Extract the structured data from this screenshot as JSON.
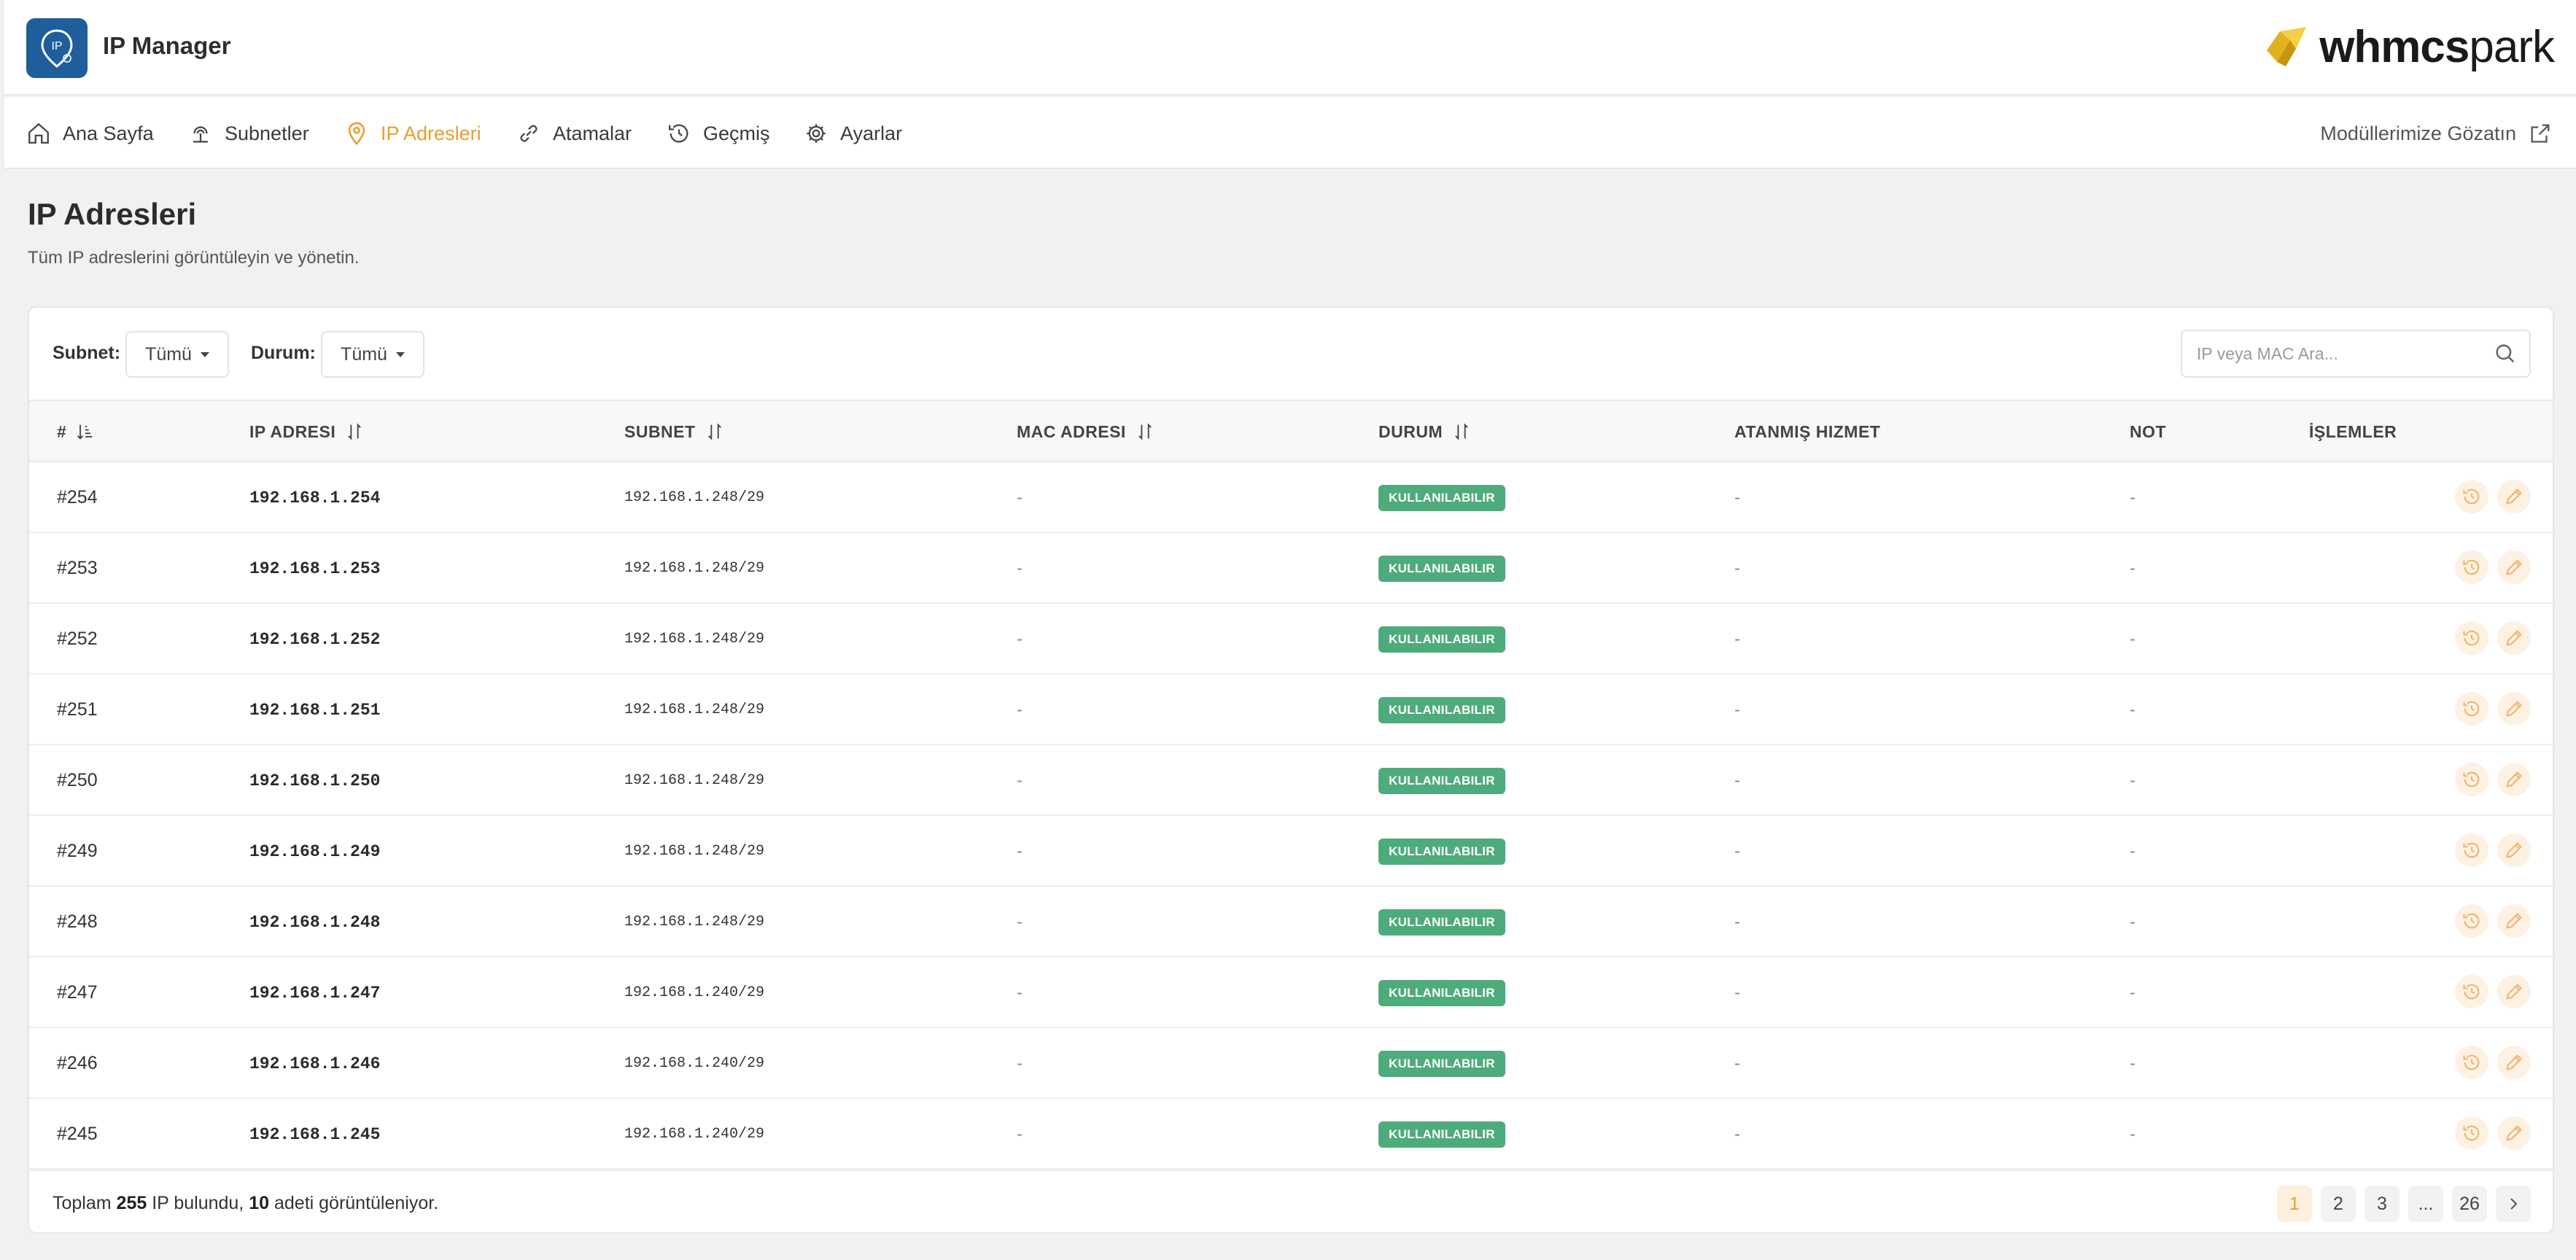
{
  "header": {
    "logo_text": "IP",
    "app_title": "IP Manager",
    "brand_bold": "whmcs",
    "brand_light": "park"
  },
  "nav": {
    "items": [
      {
        "label": "Ana Sayfa",
        "icon": "home-icon"
      },
      {
        "label": "Subnetler",
        "icon": "network-icon"
      },
      {
        "label": "IP Adresleri",
        "icon": "map-pin-icon",
        "active": true
      },
      {
        "label": "Atamalar",
        "icon": "link-icon"
      },
      {
        "label": "Geçmiş",
        "icon": "history-icon"
      },
      {
        "label": "Ayarlar",
        "icon": "gear-icon"
      }
    ],
    "external_link": "Modüllerimize Gözatın"
  },
  "page": {
    "title": "IP Adresleri",
    "subtitle": "Tüm IP adreslerini görüntüleyin ve yönetin."
  },
  "filters": {
    "subnet_label": "Subnet:",
    "subnet_value": "Tümü",
    "status_label": "Durum:",
    "status_value": "Tümü",
    "search_placeholder": "IP veya MAC Ara..."
  },
  "table": {
    "columns": [
      "#",
      "IP ADRESI",
      "SUBNET",
      "MAC ADRESI",
      "DURUM",
      "ATANMIŞ HIZMET",
      "NOT",
      "İŞLEMLER"
    ],
    "rows": [
      {
        "id": "#254",
        "ip": "192.168.1.254",
        "subnet": "192.168.1.248/29",
        "mac": "-",
        "status": "KULLANILABILIR",
        "service": "-",
        "note": "-"
      },
      {
        "id": "#253",
        "ip": "192.168.1.253",
        "subnet": "192.168.1.248/29",
        "mac": "-",
        "status": "KULLANILABILIR",
        "service": "-",
        "note": "-"
      },
      {
        "id": "#252",
        "ip": "192.168.1.252",
        "subnet": "192.168.1.248/29",
        "mac": "-",
        "status": "KULLANILABILIR",
        "service": "-",
        "note": "-"
      },
      {
        "id": "#251",
        "ip": "192.168.1.251",
        "subnet": "192.168.1.248/29",
        "mac": "-",
        "status": "KULLANILABILIR",
        "service": "-",
        "note": "-"
      },
      {
        "id": "#250",
        "ip": "192.168.1.250",
        "subnet": "192.168.1.248/29",
        "mac": "-",
        "status": "KULLANILABILIR",
        "service": "-",
        "note": "-"
      },
      {
        "id": "#249",
        "ip": "192.168.1.249",
        "subnet": "192.168.1.248/29",
        "mac": "-",
        "status": "KULLANILABILIR",
        "service": "-",
        "note": "-"
      },
      {
        "id": "#248",
        "ip": "192.168.1.248",
        "subnet": "192.168.1.248/29",
        "mac": "-",
        "status": "KULLANILABILIR",
        "service": "-",
        "note": "-"
      },
      {
        "id": "#247",
        "ip": "192.168.1.247",
        "subnet": "192.168.1.240/29",
        "mac": "-",
        "status": "KULLANILABILIR",
        "service": "-",
        "note": "-"
      },
      {
        "id": "#246",
        "ip": "192.168.1.246",
        "subnet": "192.168.1.240/29",
        "mac": "-",
        "status": "KULLANILABILIR",
        "service": "-",
        "note": "-"
      },
      {
        "id": "#245",
        "ip": "192.168.1.245",
        "subnet": "192.168.1.240/29",
        "mac": "-",
        "status": "KULLANILABILIR",
        "service": "-",
        "note": "-"
      }
    ]
  },
  "footer": {
    "summary_prefix": "Toplam",
    "total": "255",
    "summary_mid": "IP bulundu,",
    "shown": "10",
    "summary_suffix": "adeti görüntüleniyor.",
    "pages": [
      "1",
      "2",
      "3",
      "...",
      "26"
    ],
    "current_page": "1"
  },
  "colors": {
    "accent": "#e89e2d",
    "status_available": "#4eab7c",
    "logo_bg": "#1f5d9b"
  }
}
